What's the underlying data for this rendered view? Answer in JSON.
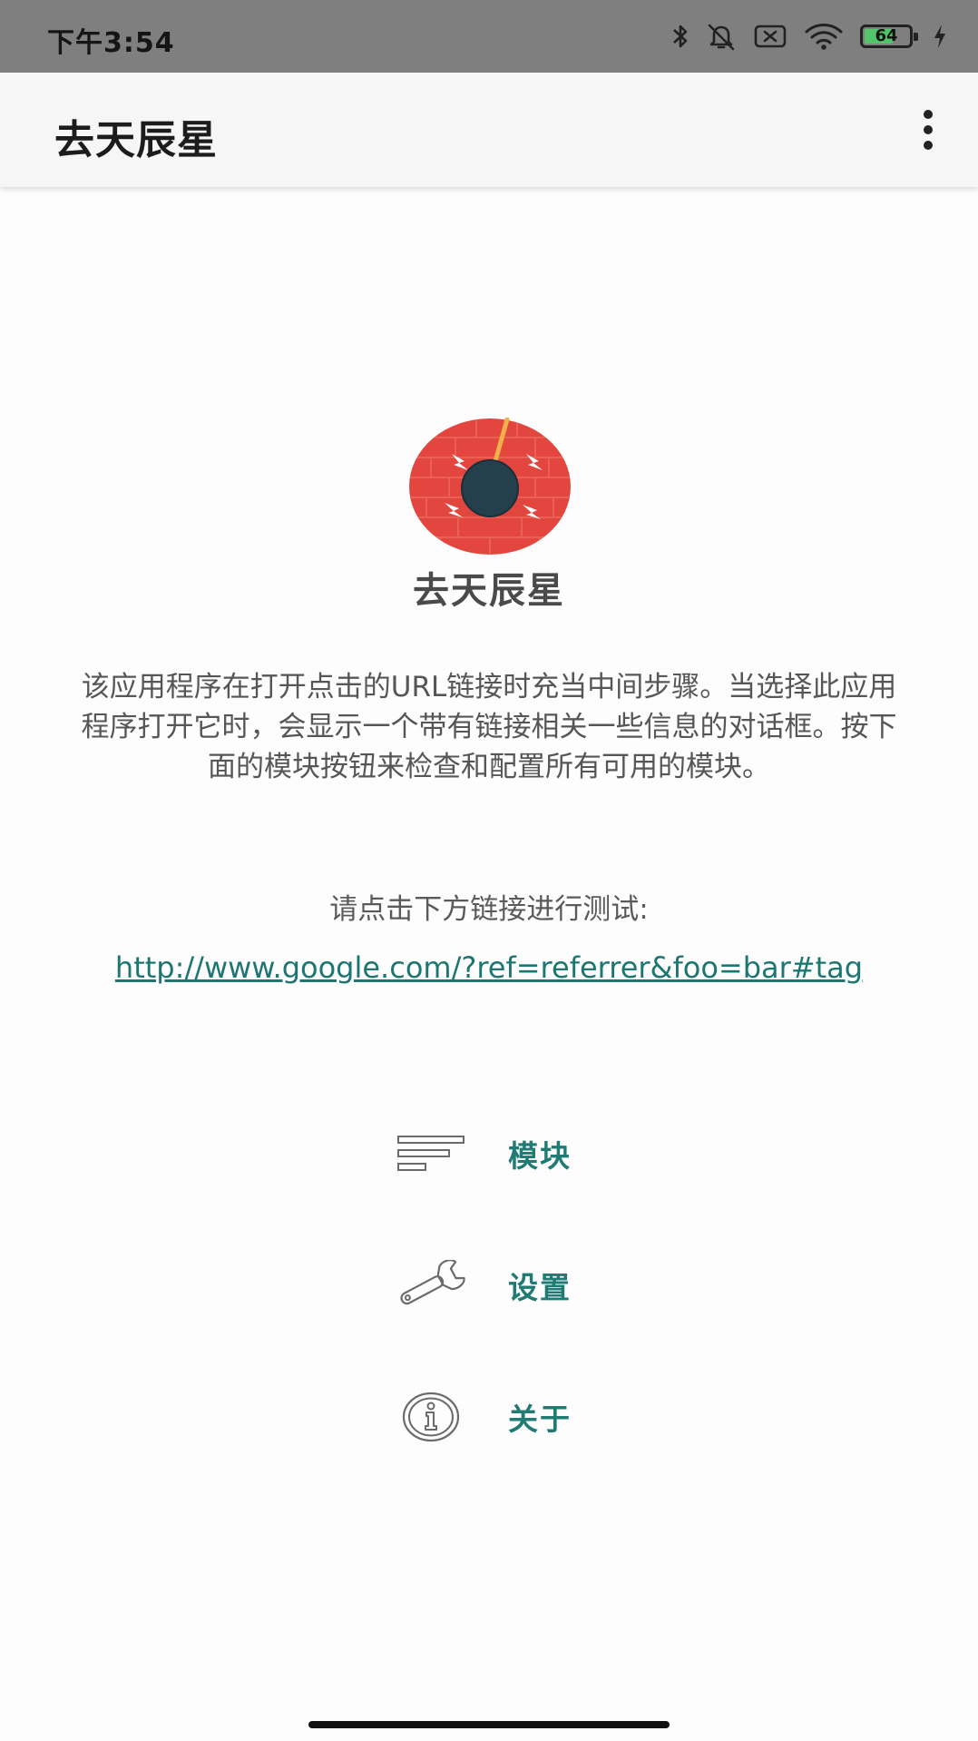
{
  "status_bar": {
    "time": "下午3:54",
    "battery_level": 64,
    "battery_text": "64",
    "icons": [
      "bluetooth-icon",
      "bell-off-icon",
      "sim-off-icon",
      "wifi-icon",
      "battery-icon",
      "charging-icon"
    ]
  },
  "app_bar": {
    "title": "去天辰星",
    "overflow_icon": "more-vertical-icon"
  },
  "main": {
    "logo_icon": "app-logo-icon",
    "app_name": "去天辰星",
    "description": "该应用程序在打开点击的URL链接时充当中间步骤。当选择此应用程序打开它时，会显示一个带有链接相关一些信息的对话框。按下面的模块按钮来检查和配置所有可用的模块。",
    "test_prompt": "请点击下方链接进行测试:",
    "test_link": "http://www.google.com/?ref=referrer&foo=bar#tag"
  },
  "menu": {
    "items": [
      {
        "label": "模块",
        "icon": "modules-icon"
      },
      {
        "label": "设置",
        "icon": "wrench-icon"
      },
      {
        "label": "关于",
        "icon": "info-icon"
      }
    ]
  },
  "colors": {
    "accent": "#1f7b73",
    "link": "#1d7670",
    "logo_red": "#e2463e",
    "logo_dark": "#25404d",
    "status_bar_bg": "#7f7f7f"
  }
}
